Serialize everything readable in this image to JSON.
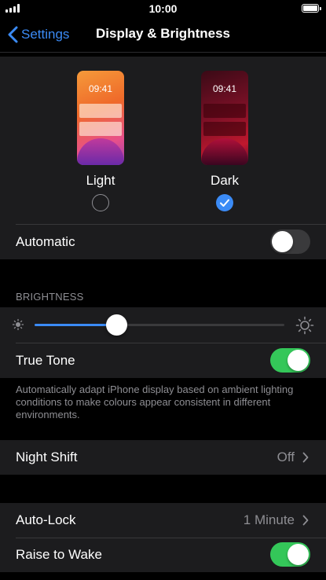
{
  "status_bar": {
    "time": "10:00"
  },
  "nav": {
    "back_label": "Settings",
    "title": "Display & Brightness"
  },
  "appearance": {
    "light": {
      "preview_time": "09:41",
      "label": "Light",
      "selected": false
    },
    "dark": {
      "preview_time": "09:41",
      "label": "Dark",
      "selected": true
    },
    "automatic": {
      "label": "Automatic",
      "enabled": false
    }
  },
  "brightness": {
    "header": "BRIGHTNESS",
    "level": 0.33,
    "true_tone": {
      "label": "True Tone",
      "enabled": true
    },
    "note": "Automatically adapt iPhone display based on ambient lighting conditions to make colours appear consistent in different environments."
  },
  "night_shift": {
    "label": "Night Shift",
    "value": "Off"
  },
  "lock": {
    "auto_lock": {
      "label": "Auto-Lock",
      "value": "1 Minute"
    },
    "raise_to_wake": {
      "label": "Raise to Wake",
      "enabled": true
    }
  },
  "colors": {
    "accent": "#3b8bf6",
    "switch_on": "#34c759",
    "switch_off": "#3a3a3c",
    "cell": "#1c1c1e"
  }
}
